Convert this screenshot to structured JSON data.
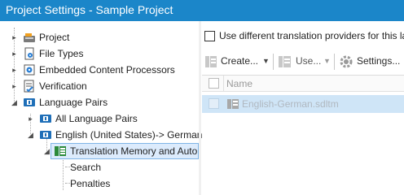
{
  "window": {
    "title": "Project Settings - Sample Project"
  },
  "tree": {
    "items": [
      {
        "label": "Project",
        "icon": "project-icon"
      },
      {
        "label": "File Types",
        "icon": "file-types-icon"
      },
      {
        "label": "Embedded Content Processors",
        "icon": "embedded-content-icon"
      },
      {
        "label": "Verification",
        "icon": "verification-icon"
      },
      {
        "label": "Language Pairs",
        "icon": "language-pairs-icon"
      },
      {
        "label": "All Language Pairs",
        "icon": "language-pairs-icon"
      },
      {
        "label": "English (United States)-> German (",
        "icon": "language-pairs-icon"
      },
      {
        "label": "Translation Memory and Auto",
        "icon": "translation-memory-icon"
      },
      {
        "label": "Search",
        "icon": ""
      },
      {
        "label": "Penalties",
        "icon": ""
      }
    ]
  },
  "options": {
    "use_different_providers": "Use different translation providers for this la"
  },
  "toolbar": {
    "create_label": "Create...",
    "use_label": "Use...",
    "settings_label": "Settings..."
  },
  "grid": {
    "header": "Name",
    "rows": [
      {
        "name": "English-German.sdltm"
      }
    ]
  },
  "colors": {
    "titlebar": "#1b86c9",
    "selection": "#dcebfc",
    "row_selection": "#cfe5f7"
  }
}
